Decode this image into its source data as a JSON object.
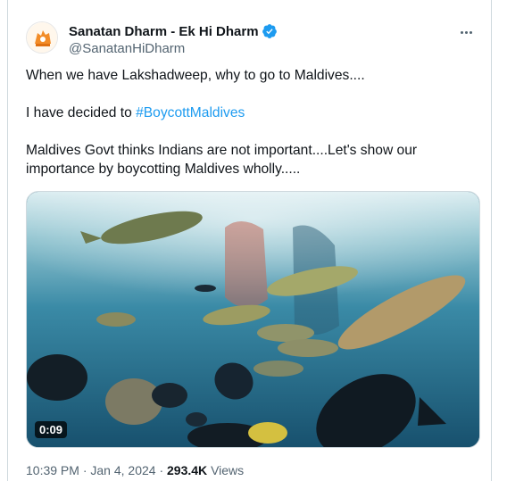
{
  "author": {
    "display_name": "Sanatan Dharm - Ek Hi Dharm",
    "handle": "@SanatanHiDharm",
    "verified": true
  },
  "post": {
    "line1": "When we have Lakshadweep, why to go to Maldives....",
    "line2_prefix": "I have decided to ",
    "line2_hashtag": "#BoycottMaldives",
    "line3": "Maldives Govt thinks Indians are not important....Let's show our importance by boycotting Maldives wholly....."
  },
  "media": {
    "duration": "0:09"
  },
  "meta": {
    "time": "10:39 PM",
    "separator": "·",
    "date": "Jan 4, 2024",
    "views_count": "293.4K",
    "views_label": "Views"
  },
  "colors": {
    "accent": "#1d9bf0",
    "secondary_text": "#536471"
  }
}
